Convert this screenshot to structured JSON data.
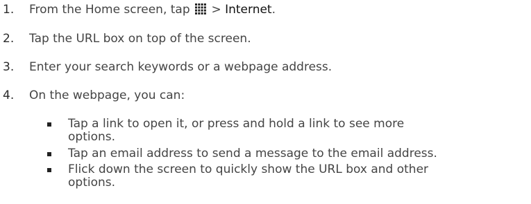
{
  "steps": [
    {
      "number": "1.",
      "text_before": "From the Home screen, tap",
      "icon": "apps-grid-icon",
      "text_sep": ">",
      "bold": "Internet",
      "text_after": "."
    },
    {
      "number": "2.",
      "text": "Tap the URL box on top of the screen."
    },
    {
      "number": "3.",
      "text": "Enter your search keywords or a webpage address."
    },
    {
      "number": "4.",
      "text": "On the webpage, you can:"
    }
  ],
  "bullets": [
    {
      "line1": "Tap a link to open it, or press and hold a link to see more",
      "line2": "options."
    },
    {
      "line1": "Tap an email address to send a message to the email address.",
      "line2": ""
    },
    {
      "line1": "Flick down the screen to quickly show the URL box and other",
      "line2": "options."
    }
  ]
}
